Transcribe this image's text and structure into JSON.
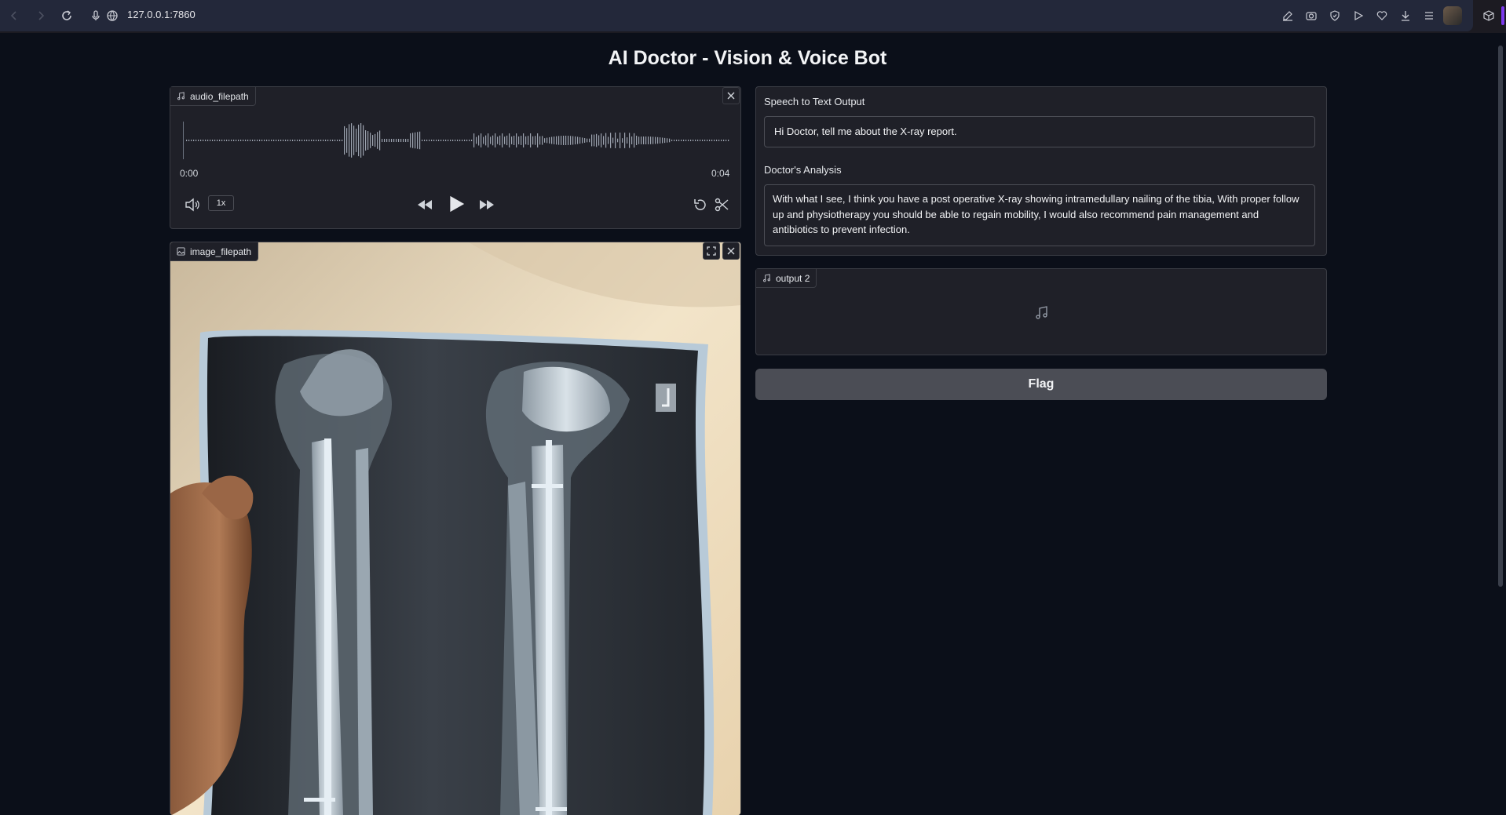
{
  "browser": {
    "url": "127.0.0.1:7860"
  },
  "page": {
    "title": "AI Doctor - Vision & Voice Bot"
  },
  "audio_input": {
    "label": "audio_filepath",
    "time_current": "0:00",
    "time_total": "0:04",
    "playback_speed": "1x"
  },
  "image_input": {
    "label": "image_filepath"
  },
  "speech_to_text": {
    "label": "Speech to Text Output",
    "value": "Hi Doctor, tell me about the X-ray report."
  },
  "doctor_analysis": {
    "label": "Doctor's Analysis",
    "value": "With what I see, I think you have a post operative X-ray showing intramedullary nailing of the tibia, With proper follow up and physiotherapy you should be able to regain mobility, I would also recommend pain management and antibiotics to prevent infection."
  },
  "audio_output": {
    "label": "output 2"
  },
  "flag_button": {
    "label": "Flag"
  },
  "colors": {
    "background": "#0b0f19",
    "panel": "#1f2028",
    "border": "#3b3d45",
    "button": "#4b4d55"
  }
}
